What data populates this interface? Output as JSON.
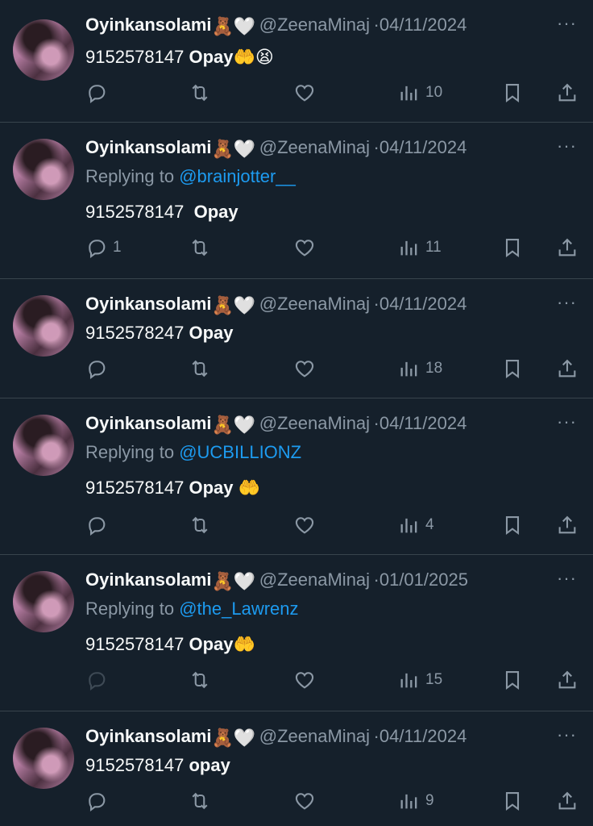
{
  "tweets": [
    {
      "name": "Oyinkansolami",
      "name_emojis": "🧸🤍",
      "handle": "@ZeenaMinaj",
      "separator": "·",
      "date": "04/11/2024",
      "more": "···",
      "replying_prefix": "",
      "replying_to": "",
      "number": "9152578147",
      "word": "Opay",
      "trailing_emoji": "🤲😫",
      "reply_count": "",
      "views": "10"
    },
    {
      "name": "Oyinkansolami",
      "name_emojis": "🧸🤍",
      "handle": "@ZeenaMinaj",
      "separator": "·",
      "date": "04/11/2024",
      "more": "···",
      "replying_prefix": "Replying to",
      "replying_to": "@brainjotter__",
      "number": "9152578147",
      "word": "Opay",
      "trailing_emoji": "",
      "reply_count": "1",
      "views": "11"
    },
    {
      "name": "Oyinkansolami",
      "name_emojis": "🧸🤍",
      "handle": "@ZeenaMinaj",
      "separator": "·",
      "date": "04/11/2024",
      "more": "···",
      "replying_prefix": "",
      "replying_to": "",
      "number": "9152578247",
      "word": "Opay",
      "trailing_emoji": "",
      "reply_count": "",
      "views": "18"
    },
    {
      "name": "Oyinkansolami",
      "name_emojis": "🧸🤍",
      "handle": "@ZeenaMinaj",
      "separator": "·",
      "date": "04/11/2024",
      "more": "···",
      "replying_prefix": "Replying to",
      "replying_to": "@UCBILLIONZ",
      "number": "9152578147",
      "word": "Opay",
      "trailing_emoji": "🤲",
      "reply_count": "",
      "views": "4"
    },
    {
      "name": "Oyinkansolami",
      "name_emojis": "🧸🤍",
      "handle": "@ZeenaMinaj",
      "separator": "·",
      "date": "01/01/2025",
      "more": "···",
      "replying_prefix": "Replying to",
      "replying_to": "@the_Lawrenz",
      "number": "9152578147",
      "word": "Opay",
      "trailing_emoji": "🤲",
      "reply_count": "",
      "views": "15"
    },
    {
      "name": "Oyinkansolami",
      "name_emojis": "🧸🤍",
      "handle": "@ZeenaMinaj",
      "separator": "·",
      "date": "04/11/2024",
      "more": "···",
      "replying_prefix": "",
      "replying_to": "",
      "number": "9152578147",
      "word": "opay",
      "trailing_emoji": "",
      "reply_count": "",
      "views": "9"
    }
  ],
  "icons": {
    "reply": "reply-icon",
    "retweet": "retweet-icon",
    "like": "heart-icon",
    "views": "views-icon",
    "bookmark": "bookmark-icon",
    "share": "share-icon"
  },
  "colors": {
    "background": "#15202b",
    "text": "#f7f9f9",
    "muted": "#8b98a5",
    "mention": "#1d9bf0",
    "divider": "#38444d"
  }
}
